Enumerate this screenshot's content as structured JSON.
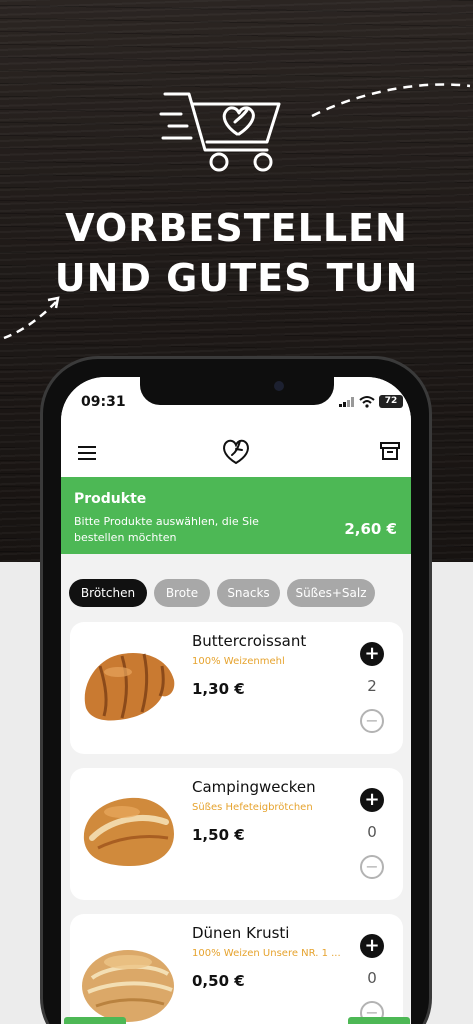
{
  "headline": {
    "line1": "VORBESTELLEN",
    "line2": "UND GUTES TUN"
  },
  "status_bar": {
    "time": "09:31",
    "battery": "72"
  },
  "banner": {
    "title": "Produkte",
    "subtitle": "Bitte Produkte auswählen, die Sie bestellen möchten",
    "total": "2,60 €"
  },
  "categories": [
    {
      "label": "Brötchen",
      "active": true
    },
    {
      "label": "Brote",
      "active": false
    },
    {
      "label": "Snacks",
      "active": false
    },
    {
      "label": "Süßes+Salz",
      "active": false
    }
  ],
  "products": [
    {
      "name": "Buttercroissant",
      "description": "100% Weizenmehl",
      "price": "1,30 €",
      "quantity": "2"
    },
    {
      "name": "Campingwecken",
      "description": "Süßes Hefeteigbrötchen",
      "price": "1,50 €",
      "quantity": "0"
    },
    {
      "name": "Dünen Krusti",
      "description": "100% Weizen Unsere NR. 1 ...",
      "price": "0,50 €",
      "quantity": "0"
    }
  ],
  "colors": {
    "accent_green": "#4db855",
    "description_orange": "#e6a32e",
    "dark": "#111111"
  },
  "icons": [
    "cart-heart-icon",
    "menu-icon",
    "logo-icon",
    "archive-icon",
    "plus-icon",
    "minus-icon",
    "signal-icon",
    "wifi-icon"
  ]
}
